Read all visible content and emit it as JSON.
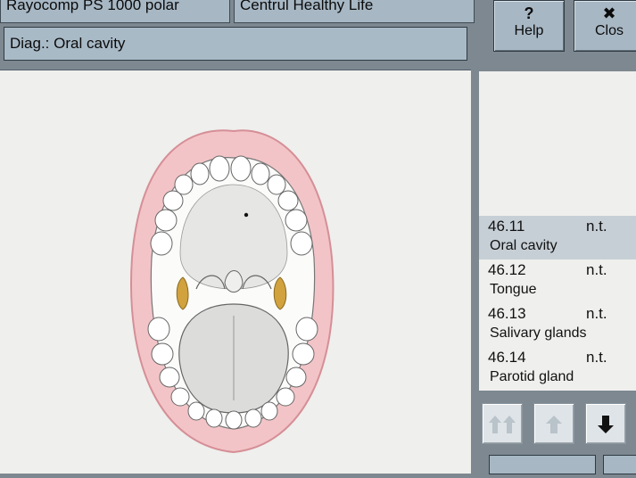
{
  "header": {
    "tab_program": "Rayocomp PS 1000 polar",
    "tab_profile": "Centrul Healthy Life",
    "diag_label": "Diag.: Oral cavity"
  },
  "toolbar": {
    "help_glyph": "?",
    "help_label": "Help",
    "close_glyph": "✖",
    "close_label": "Clos"
  },
  "diagnosis_list": {
    "items": [
      {
        "code": "46.11",
        "status": "n.t.",
        "name": "Oral cavity",
        "selected": true
      },
      {
        "code": "46.12",
        "status": "n.t.",
        "name": "Tongue",
        "selected": false
      },
      {
        "code": "46.13",
        "status": "n.t.",
        "name": "Salivary glands",
        "selected": false
      },
      {
        "code": "46.14",
        "status": "n.t.",
        "name": "Parotid gland",
        "selected": false
      }
    ]
  },
  "nav": {
    "icons": [
      "double-up-arrow-icon",
      "up-arrow-icon",
      "down-arrow-icon"
    ]
  },
  "colors": {
    "panel": "#efefed",
    "chrome": "#a7b7c4",
    "lip": "#f0b7bb",
    "gland": "#d1a23d"
  }
}
